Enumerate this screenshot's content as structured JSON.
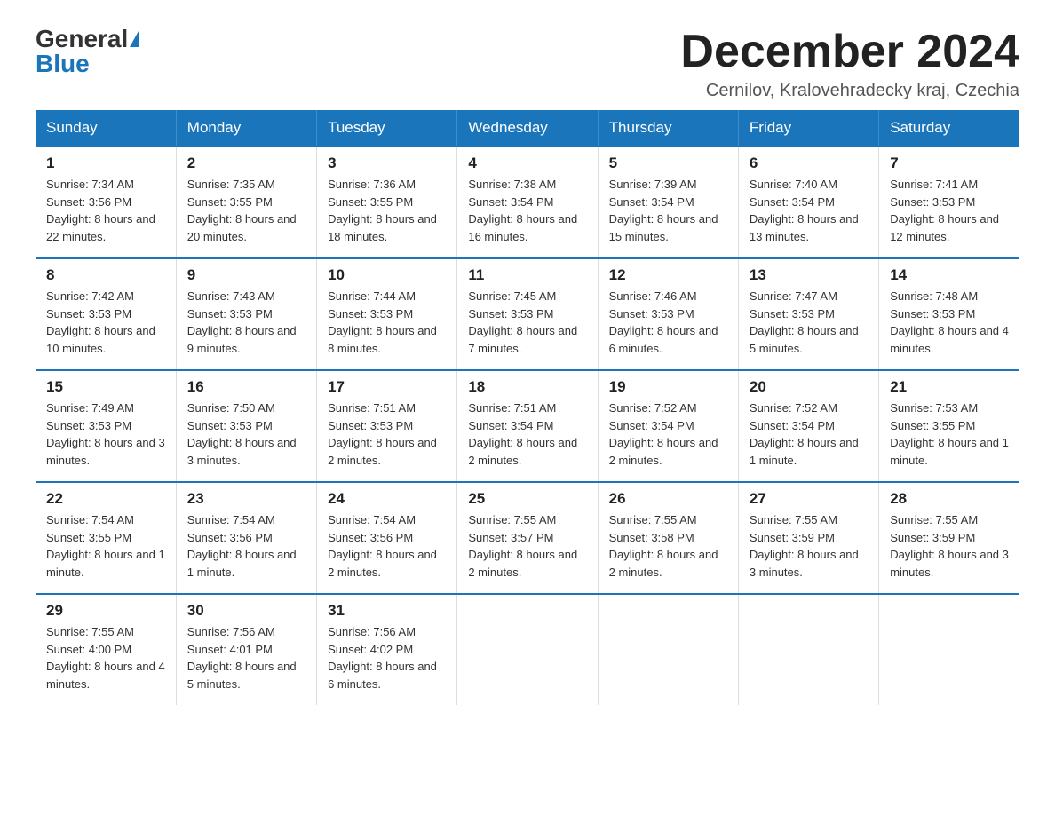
{
  "header": {
    "logo_general": "General",
    "logo_blue": "Blue",
    "month_title": "December 2024",
    "subtitle": "Cernilov, Kralovehradecky kraj, Czechia"
  },
  "weekdays": [
    "Sunday",
    "Monday",
    "Tuesday",
    "Wednesday",
    "Thursday",
    "Friday",
    "Saturday"
  ],
  "weeks": [
    [
      {
        "day": "1",
        "sunrise": "7:34 AM",
        "sunset": "3:56 PM",
        "daylight": "8 hours and 22 minutes."
      },
      {
        "day": "2",
        "sunrise": "7:35 AM",
        "sunset": "3:55 PM",
        "daylight": "8 hours and 20 minutes."
      },
      {
        "day": "3",
        "sunrise": "7:36 AM",
        "sunset": "3:55 PM",
        "daylight": "8 hours and 18 minutes."
      },
      {
        "day": "4",
        "sunrise": "7:38 AM",
        "sunset": "3:54 PM",
        "daylight": "8 hours and 16 minutes."
      },
      {
        "day": "5",
        "sunrise": "7:39 AM",
        "sunset": "3:54 PM",
        "daylight": "8 hours and 15 minutes."
      },
      {
        "day": "6",
        "sunrise": "7:40 AM",
        "sunset": "3:54 PM",
        "daylight": "8 hours and 13 minutes."
      },
      {
        "day": "7",
        "sunrise": "7:41 AM",
        "sunset": "3:53 PM",
        "daylight": "8 hours and 12 minutes."
      }
    ],
    [
      {
        "day": "8",
        "sunrise": "7:42 AM",
        "sunset": "3:53 PM",
        "daylight": "8 hours and 10 minutes."
      },
      {
        "day": "9",
        "sunrise": "7:43 AM",
        "sunset": "3:53 PM",
        "daylight": "8 hours and 9 minutes."
      },
      {
        "day": "10",
        "sunrise": "7:44 AM",
        "sunset": "3:53 PM",
        "daylight": "8 hours and 8 minutes."
      },
      {
        "day": "11",
        "sunrise": "7:45 AM",
        "sunset": "3:53 PM",
        "daylight": "8 hours and 7 minutes."
      },
      {
        "day": "12",
        "sunrise": "7:46 AM",
        "sunset": "3:53 PM",
        "daylight": "8 hours and 6 minutes."
      },
      {
        "day": "13",
        "sunrise": "7:47 AM",
        "sunset": "3:53 PM",
        "daylight": "8 hours and 5 minutes."
      },
      {
        "day": "14",
        "sunrise": "7:48 AM",
        "sunset": "3:53 PM",
        "daylight": "8 hours and 4 minutes."
      }
    ],
    [
      {
        "day": "15",
        "sunrise": "7:49 AM",
        "sunset": "3:53 PM",
        "daylight": "8 hours and 3 minutes."
      },
      {
        "day": "16",
        "sunrise": "7:50 AM",
        "sunset": "3:53 PM",
        "daylight": "8 hours and 3 minutes."
      },
      {
        "day": "17",
        "sunrise": "7:51 AM",
        "sunset": "3:53 PM",
        "daylight": "8 hours and 2 minutes."
      },
      {
        "day": "18",
        "sunrise": "7:51 AM",
        "sunset": "3:54 PM",
        "daylight": "8 hours and 2 minutes."
      },
      {
        "day": "19",
        "sunrise": "7:52 AM",
        "sunset": "3:54 PM",
        "daylight": "8 hours and 2 minutes."
      },
      {
        "day": "20",
        "sunrise": "7:52 AM",
        "sunset": "3:54 PM",
        "daylight": "8 hours and 1 minute."
      },
      {
        "day": "21",
        "sunrise": "7:53 AM",
        "sunset": "3:55 PM",
        "daylight": "8 hours and 1 minute."
      }
    ],
    [
      {
        "day": "22",
        "sunrise": "7:54 AM",
        "sunset": "3:55 PM",
        "daylight": "8 hours and 1 minute."
      },
      {
        "day": "23",
        "sunrise": "7:54 AM",
        "sunset": "3:56 PM",
        "daylight": "8 hours and 1 minute."
      },
      {
        "day": "24",
        "sunrise": "7:54 AM",
        "sunset": "3:56 PM",
        "daylight": "8 hours and 2 minutes."
      },
      {
        "day": "25",
        "sunrise": "7:55 AM",
        "sunset": "3:57 PM",
        "daylight": "8 hours and 2 minutes."
      },
      {
        "day": "26",
        "sunrise": "7:55 AM",
        "sunset": "3:58 PM",
        "daylight": "8 hours and 2 minutes."
      },
      {
        "day": "27",
        "sunrise": "7:55 AM",
        "sunset": "3:59 PM",
        "daylight": "8 hours and 3 minutes."
      },
      {
        "day": "28",
        "sunrise": "7:55 AM",
        "sunset": "3:59 PM",
        "daylight": "8 hours and 3 minutes."
      }
    ],
    [
      {
        "day": "29",
        "sunrise": "7:55 AM",
        "sunset": "4:00 PM",
        "daylight": "8 hours and 4 minutes."
      },
      {
        "day": "30",
        "sunrise": "7:56 AM",
        "sunset": "4:01 PM",
        "daylight": "8 hours and 5 minutes."
      },
      {
        "day": "31",
        "sunrise": "7:56 AM",
        "sunset": "4:02 PM",
        "daylight": "8 hours and 6 minutes."
      },
      null,
      null,
      null,
      null
    ]
  ]
}
